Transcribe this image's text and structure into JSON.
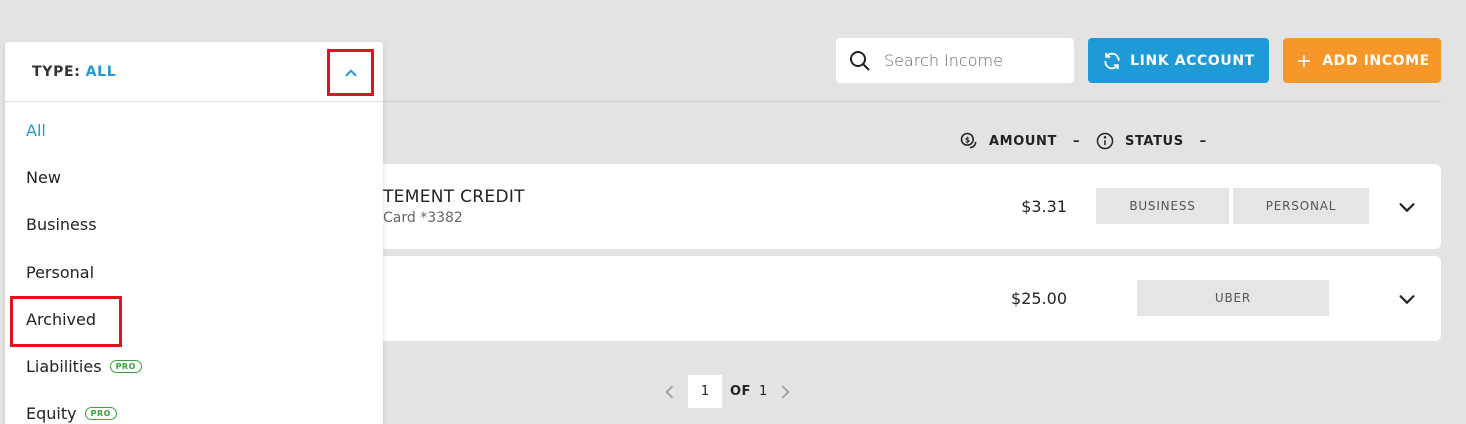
{
  "toolbar": {
    "search_placeholder": "Search Income",
    "link_account_label": "LINK ACCOUNT",
    "add_income_label": "ADD INCOME"
  },
  "columns": {
    "amount_label": "AMOUNT",
    "amount_sort": "–",
    "status_label": "STATUS",
    "status_sort": "–"
  },
  "rows": [
    {
      "title": "TEMENT CREDIT",
      "subtitle": "Card *3382",
      "amount": "$3.31",
      "tags": [
        "BUSINESS",
        "PERSONAL"
      ]
    },
    {
      "title": "",
      "subtitle": "",
      "amount": "$25.00",
      "tags": [
        "UBER"
      ]
    }
  ],
  "pagination": {
    "current_page": "1",
    "of_label": "OF",
    "total_pages": "1"
  },
  "dropdown": {
    "type_label": "TYPE:",
    "type_value": "ALL",
    "items": [
      {
        "label": "All",
        "active": true
      },
      {
        "label": "New"
      },
      {
        "label": "Business"
      },
      {
        "label": "Personal"
      },
      {
        "label": "Archived",
        "highlighted": true
      },
      {
        "label": "Liabilities",
        "badge": "PRO"
      },
      {
        "label": "Equity",
        "badge": "PRO"
      }
    ]
  },
  "colors": {
    "accent_blue": "#1e9ad6",
    "accent_orange": "#f7972a",
    "highlight_red": "#e0141e",
    "pro_green": "#3aa23a"
  }
}
